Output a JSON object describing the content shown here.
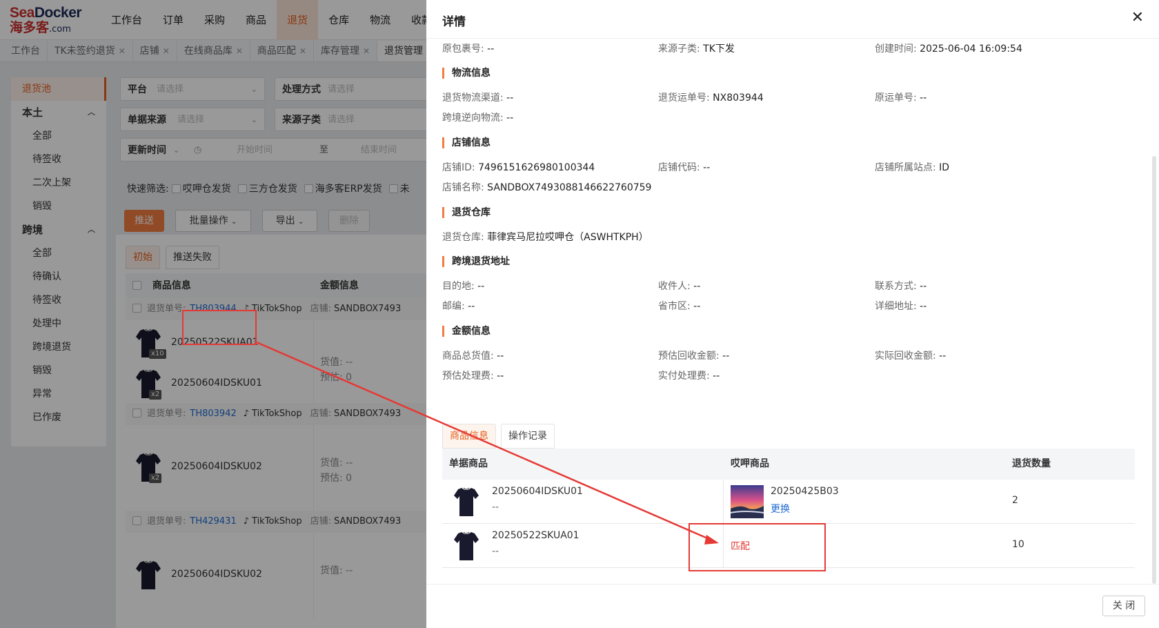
{
  "logo": {
    "top_a": "Sea",
    "top_b": "Docker",
    "bottom_a": "海多客",
    "bottom_b": ".com"
  },
  "nav": [
    "工作台",
    "订单",
    "采购",
    "商品",
    "退货",
    "仓库",
    "物流",
    "收款"
  ],
  "nav_active_index": 4,
  "tabs": [
    {
      "label": "工作台",
      "closable": false
    },
    {
      "label": "TK未签约退货",
      "closable": true
    },
    {
      "label": "店铺",
      "closable": true
    },
    {
      "label": "在线商品库",
      "closable": true
    },
    {
      "label": "商品匹配",
      "closable": true
    },
    {
      "label": "库存管理",
      "closable": true
    },
    {
      "label": "退货管理",
      "closable": true
    }
  ],
  "sidebar": {
    "pool": "退货池",
    "local": {
      "label": "本土",
      "items": [
        "全部",
        "待签收",
        "二次上架",
        "销毁"
      ]
    },
    "cross": {
      "label": "跨境",
      "items": [
        "全部",
        "待确认",
        "待签收",
        "处理中",
        "跨境退货",
        "销毁",
        "异常",
        "已作废"
      ]
    }
  },
  "filters": {
    "platform_label": "平台",
    "platform_placeholder": "请选择",
    "method_label": "处理方式",
    "method_placeholder": "请选择",
    "source_label": "单据来源",
    "source_placeholder": "请选择",
    "subsource_label": "来源子类",
    "subsource_placeholder": "请选择",
    "time_label": "更新时间",
    "start_placeholder": "开始时间",
    "to": "至",
    "end_placeholder": "结束时间",
    "quick_label": "快速筛选:",
    "quick": [
      "哎呷仓发货",
      "三方仓发货",
      "海多客ERP发货",
      "未"
    ]
  },
  "actions": {
    "push": "推送",
    "batch": "批量操作",
    "export": "导出",
    "delete": "删除"
  },
  "list": {
    "status_tabs": [
      "初始",
      "推送失败"
    ],
    "col_goods": "商品信息",
    "col_amount": "金额信息",
    "order_label": "退货单号:",
    "platform": "TikTokShop",
    "shop_label": "店铺:",
    "shop_value": "SANDBOX7493",
    "goods_value_label": "货值:",
    "estimate_label": "预估:",
    "orders": [
      {
        "id": "TH803944",
        "items": [
          {
            "sku": "20250522SKUA01",
            "qty": "x10"
          },
          {
            "sku": "20250604IDSKU01",
            "qty": "x2"
          }
        ],
        "goods_value": "--",
        "estimate": "0"
      },
      {
        "id": "TH803942",
        "items": [
          {
            "sku": "20250604IDSKU02",
            "qty": "x2"
          }
        ],
        "goods_value": "--",
        "estimate": "0"
      },
      {
        "id": "TH429431",
        "items": [
          {
            "sku": "20250604IDSKU02",
            "qty": ""
          }
        ],
        "goods_value": "--",
        "estimate": ""
      }
    ]
  },
  "drawer": {
    "title": "详情",
    "top_row": [
      {
        "k": "原包裹号:",
        "v": "--"
      },
      {
        "k": "来源子类:",
        "v": "TK下发"
      },
      {
        "k": "创建时间:",
        "v": "2025-06-04 16:09:54"
      }
    ],
    "logistics": {
      "title": "物流信息",
      "rows": [
        [
          {
            "k": "退货物流渠道:",
            "v": "--"
          },
          {
            "k": "退货运单号:",
            "v": "NX803944"
          },
          {
            "k": "原运单号:",
            "v": "--"
          }
        ],
        [
          {
            "k": "跨境逆向物流:",
            "v": "--"
          }
        ]
      ]
    },
    "shop": {
      "title": "店铺信息",
      "rows": [
        [
          {
            "k": "店铺ID:",
            "v": "7496151626980100344"
          },
          {
            "k": "店铺代码:",
            "v": "--"
          },
          {
            "k": "店铺所属站点:",
            "v": "ID"
          }
        ],
        [
          {
            "k": "店铺名称:",
            "v": "SANDBOX7493088146622760759"
          }
        ]
      ]
    },
    "warehouse": {
      "title": "退货仓库",
      "rows": [
        [
          {
            "k": "退货仓库:",
            "v": "菲律宾马尼拉哎呷仓（ASWHTKPH）"
          }
        ]
      ]
    },
    "cross_address": {
      "title": "跨境退货地址",
      "rows": [
        [
          {
            "k": "目的地:",
            "v": "--"
          },
          {
            "k": "收件人:",
            "v": "--"
          },
          {
            "k": "联系方式:",
            "v": "--"
          }
        ],
        [
          {
            "k": "邮编:",
            "v": "--"
          },
          {
            "k": "省市区:",
            "v": "--"
          },
          {
            "k": "详细地址:",
            "v": "--"
          }
        ]
      ]
    },
    "amount": {
      "title": "金额信息",
      "rows": [
        [
          {
            "k": "商品总货值:",
            "v": "--"
          },
          {
            "k": "预估回收金额:",
            "v": "--"
          },
          {
            "k": "实际回收金额:",
            "v": "--"
          }
        ],
        [
          {
            "k": "预估处理费:",
            "v": "--"
          },
          {
            "k": "实付处理费:",
            "v": "--"
          }
        ]
      ]
    },
    "tabs": [
      "商品信息",
      "操作记录"
    ],
    "goods_table": {
      "headers": [
        "单据商品",
        "哎呷商品",
        "退货数量"
      ],
      "rows": [
        {
          "sku": "20250604IDSKU01",
          "sub": "--",
          "match_sku": "20250425B03",
          "replace": "更换",
          "qty": "2"
        },
        {
          "sku": "20250522SKUA01",
          "sub": "--",
          "match": "匹配",
          "qty": "10"
        }
      ]
    },
    "close_button": "关 闭"
  },
  "colors": {
    "accent": "#f07c40",
    "link": "#1f6bd1",
    "annotation": "#e53935"
  }
}
